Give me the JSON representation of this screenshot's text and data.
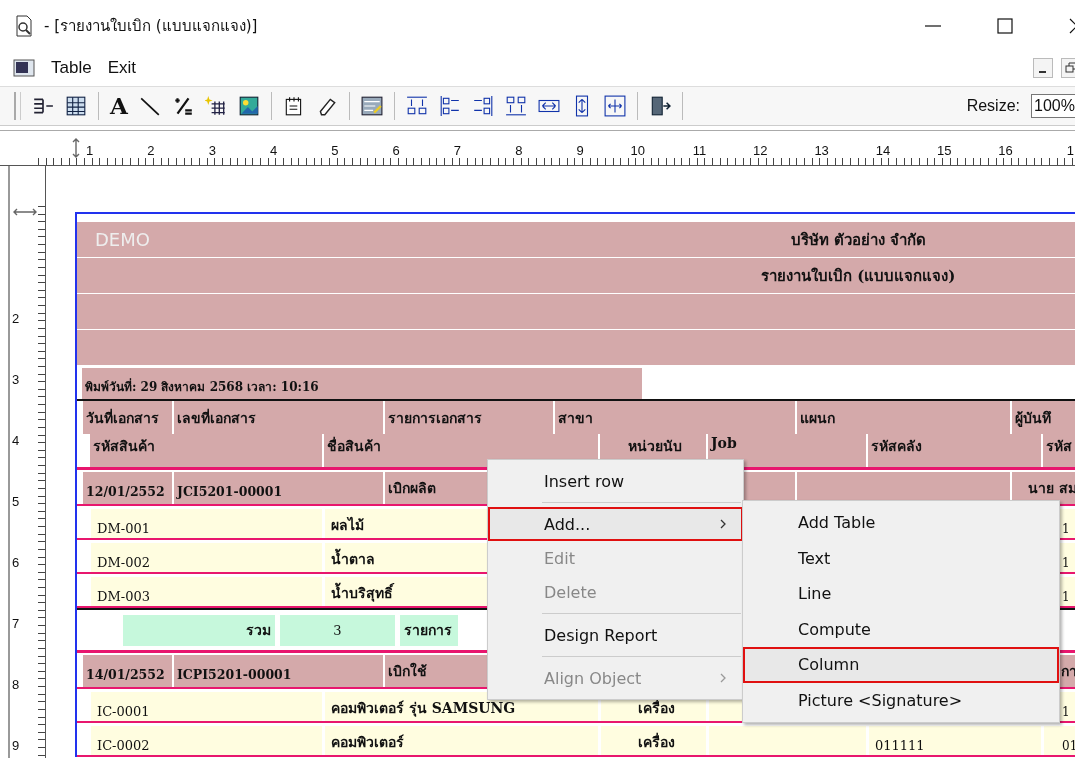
{
  "window": {
    "title": "- [รายงานใบเบิก (แบบแจกแจง)]"
  },
  "menu_bar": {
    "items": [
      "Table",
      "Exit"
    ]
  },
  "toolbar": {
    "text_tool": "A",
    "resize_label": "Resize:",
    "resize_value": "100%"
  },
  "ruler": {
    "top_labels": [
      "1",
      "2",
      "3",
      "4",
      "5",
      "6",
      "7",
      "8",
      "9",
      "10",
      "11",
      "12",
      "13",
      "14",
      "15",
      "16",
      "1"
    ],
    "left_labels": [
      "2",
      "3",
      "4",
      "5",
      "6",
      "7",
      "8",
      "9"
    ]
  },
  "report": {
    "watermark": "DEMO",
    "company": "บริษัท ตัวอย่าง จำกัด",
    "title": "รายงานใบเบิก (แบบแจกแจง)",
    "printed": "พิมพ์วันที่: 29 สิงหาคม 2568  เวลา: 10:16",
    "header_row_1": [
      "วันที่เอกสาร",
      "เลขที่เอกสาร",
      "รายการเอกสาร",
      "สาขา",
      "แผนก",
      "ผู้บันทึ"
    ],
    "header_row_2": [
      "รหัสสินค้า",
      "ชื่อสินค้า",
      "หน่วยนับ",
      "Job",
      "รหัสคลัง",
      "รหัส"
    ],
    "sections": [
      {
        "kind": "group",
        "date": "12/01/2552",
        "doc_no": "JCI5201-00001",
        "description": "เบิกผลิต",
        "recorder": "นาย สม"
      },
      {
        "kind": "item",
        "code": "DM-001",
        "name": "ผลไม้",
        "column_6": "1"
      },
      {
        "kind": "item",
        "code": "DM-002",
        "name": "น้ำตาล",
        "column_6": "1"
      },
      {
        "kind": "item",
        "code": "DM-003",
        "name": "น้ำบริสุทธิ์",
        "column_6": "1"
      },
      {
        "kind": "summary",
        "label": "รวม",
        "count": "3",
        "unit": "รายการ"
      },
      {
        "kind": "group",
        "date": "14/01/2552",
        "doc_no": "ICPI5201-00001",
        "description": "เบิกใช้",
        "recorder": "กา"
      },
      {
        "kind": "item",
        "code": "IC-0001",
        "name": "คอมพิวเตอร์ รุ่น SAMSUNG",
        "unit": "เครื่อง",
        "column_6": "1"
      },
      {
        "kind": "item",
        "code": "IC-0002",
        "name": "คอมพิวเตอร์",
        "unit": "เครื่อง",
        "warehouse": "011111",
        "column_6": "01"
      }
    ]
  },
  "context_menu": {
    "items": [
      {
        "kind": "item",
        "label": "Insert row",
        "disabled": false,
        "submenu": false,
        "highlighted": false
      },
      {
        "kind": "separator"
      },
      {
        "kind": "item",
        "label": "Add...",
        "disabled": false,
        "submenu": true,
        "highlighted": true
      },
      {
        "kind": "item",
        "label": "Edit",
        "disabled": true,
        "submenu": false,
        "highlighted": false
      },
      {
        "kind": "item",
        "label": "Delete",
        "disabled": true,
        "submenu": false,
        "highlighted": false
      },
      {
        "kind": "separator"
      },
      {
        "kind": "item",
        "label": "Design Report",
        "disabled": false,
        "submenu": false,
        "highlighted": false
      },
      {
        "kind": "separator"
      },
      {
        "kind": "item",
        "label": "Align Object",
        "disabled": true,
        "submenu": true,
        "highlighted": false
      }
    ]
  },
  "submenu": {
    "items": [
      {
        "label": "Add Table",
        "highlighted": false
      },
      {
        "label": "Text",
        "highlighted": false
      },
      {
        "label": "Line",
        "highlighted": false
      },
      {
        "label": "Compute",
        "highlighted": false
      },
      {
        "label": "Column",
        "highlighted": true
      },
      {
        "label": "Picture <Signature>",
        "highlighted": false
      }
    ]
  }
}
